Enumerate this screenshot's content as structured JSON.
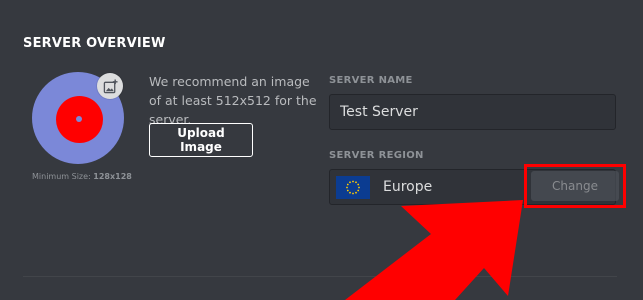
{
  "section_title": "SERVER OVERVIEW",
  "server_icon": {
    "min_size_label": "Minimum Size:",
    "min_size_value": "128x128",
    "add_image_icon": "image-plus-icon"
  },
  "upload": {
    "recommendation": "We recommend an image of at least 512x512 for the server.",
    "button_label": "Upload Image"
  },
  "server_name": {
    "label": "SERVER NAME",
    "value": "Test Server"
  },
  "server_region": {
    "label": "SERVER REGION",
    "flag_icon": "eu-flag-icon",
    "value": "Europe",
    "change_label": "Change"
  },
  "annotation": {
    "highlight_color": "#ff0000",
    "arrow_color": "#ff0000"
  },
  "colors": {
    "background": "#36393f",
    "icon_blurple": "#7b88d8",
    "input_background": "#303339",
    "change_button": "#4f545c"
  }
}
